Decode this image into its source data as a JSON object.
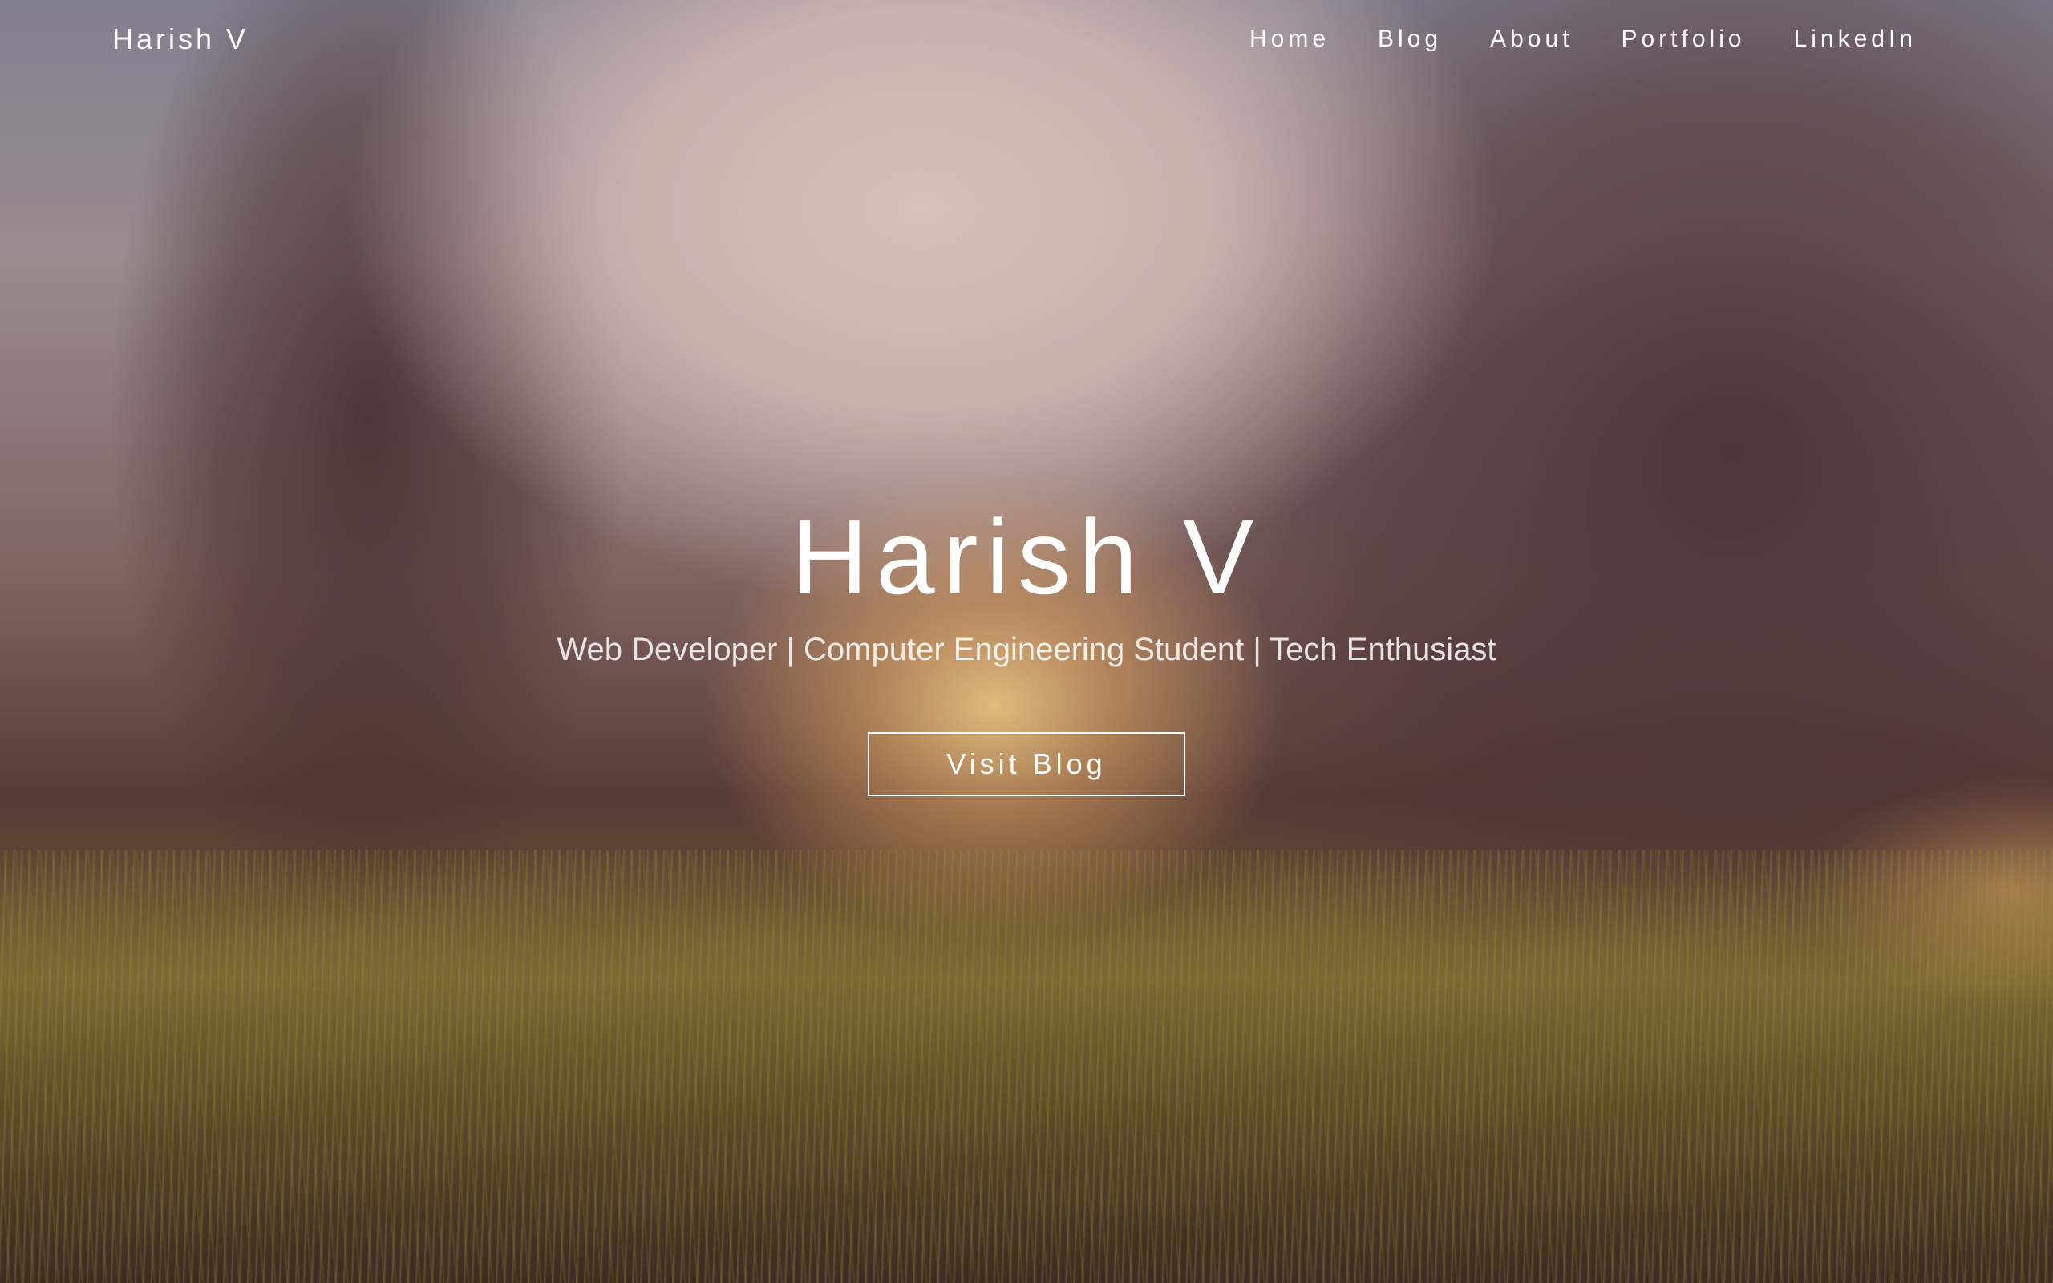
{
  "nav": {
    "brand": "Harish V",
    "items": [
      {
        "label": "Home"
      },
      {
        "label": "Blog"
      },
      {
        "label": "About"
      },
      {
        "label": "Portfolio"
      },
      {
        "label": "LinkedIn"
      }
    ]
  },
  "hero": {
    "title": "Harish V",
    "subtitle": "Web Developer | Computer Engineering Student | Tech Enthusiast",
    "cta_label": "Visit Blog"
  }
}
